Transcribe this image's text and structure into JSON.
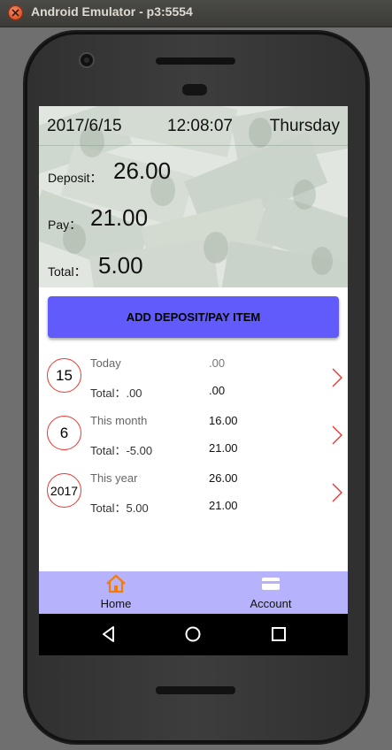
{
  "window": {
    "title": "Android Emulator - p3:5554"
  },
  "header": {
    "date": "2017/6/15",
    "time": "12:08:07",
    "weekday": "Thursday",
    "deposit_label": "Deposit：",
    "deposit_value": "26.00",
    "pay_label": "Pay：",
    "pay_value": "21.00",
    "total_label": "Total：",
    "total_value": "5.00"
  },
  "add_button": {
    "label": "ADD DEPOSIT/PAY ITEM"
  },
  "stats": [
    {
      "badge": "15",
      "period": "Today",
      "period_value": ".00",
      "total_text": "Total：.00",
      "total_value": ".00"
    },
    {
      "badge": "6",
      "period": "This month",
      "period_value": "16.00",
      "total_text": "Total：-5.00",
      "total_value": "21.00"
    },
    {
      "badge": "2017",
      "period": "This year",
      "period_value": "26.00",
      "total_text": "Total：5.00",
      "total_value": "21.00"
    }
  ],
  "tabs": [
    {
      "label": "Home",
      "icon": "home-icon",
      "color": "#f57c00"
    },
    {
      "label": "Account",
      "icon": "card-icon",
      "color": "#ffffff"
    }
  ],
  "colors": {
    "accent_button": "#625bfb",
    "tab_bar": "#b6b2fb",
    "circle_border": "#e53935"
  }
}
